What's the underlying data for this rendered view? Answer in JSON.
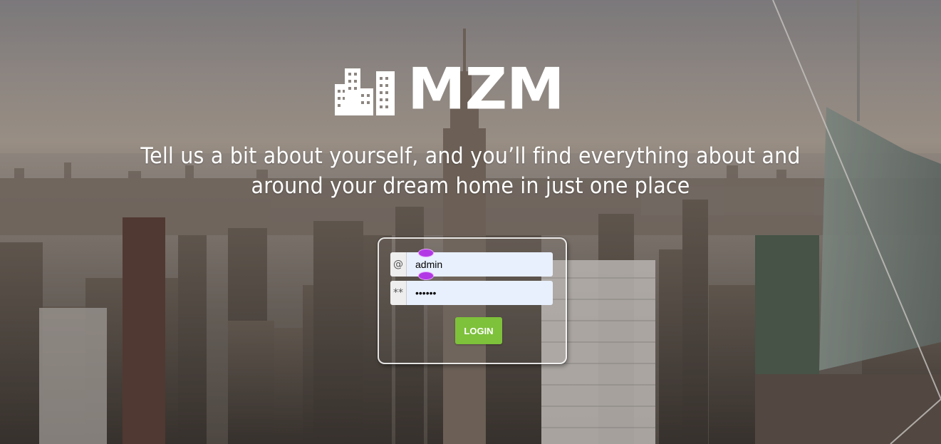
{
  "brand": {
    "name": "MZM",
    "logo_icon": "buildings-icon"
  },
  "tagline": {
    "line1": "Tell us a bit about yourself, and you’ll find everything about and",
    "line2": "around your dream home in just one place"
  },
  "login": {
    "username_addon": "@",
    "username_value": "admin",
    "password_addon": "**",
    "password_value": "admin1",
    "submit_label": "LOGIN"
  },
  "colors": {
    "accent": "#7ec13b",
    "input_autofill": "#e8f0fe",
    "autofill_marker": "#b238e6"
  }
}
